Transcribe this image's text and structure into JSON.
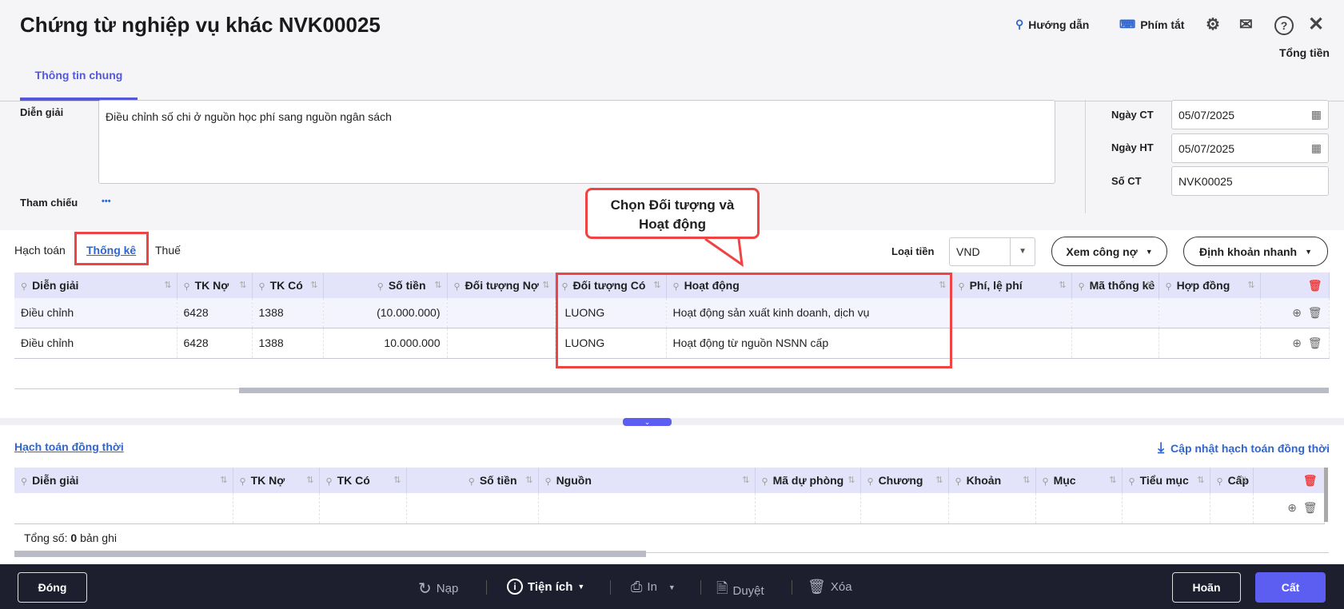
{
  "header": {
    "title": "Chứng từ nghiệp vụ khác NVK00025",
    "guide": "Hướng dẫn",
    "shortcuts": "Phím tắt",
    "total_label": "Tổng tiền"
  },
  "tabs": {
    "general": "Thông tin chung"
  },
  "form": {
    "desc_label": "Diễn giải",
    "desc_value": "Điều chỉnh số chi ở nguồn học phí sang nguồn ngân sách",
    "ref_label": "Tham chiếu",
    "ref_more": "•••",
    "date_ct_label": "Ngày CT",
    "date_ct": "05/07/2025",
    "date_ht_label": "Ngày HT",
    "date_ht": "05/07/2025",
    "so_ct_label": "Số CT",
    "so_ct": "NVK00025"
  },
  "subtabs": [
    "Hạch toán",
    "Thống kê",
    "Thuế"
  ],
  "toolbar": {
    "currency_label": "Loại tiền",
    "currency": "VND",
    "debt": "Xem công nợ",
    "quick": "Định khoản nhanh"
  },
  "callout": {
    "line1": "Chọn Đối tượng và",
    "line2": "Hoạt động"
  },
  "grid": {
    "columns": [
      "Diễn giải",
      "TK Nợ",
      "TK Có",
      "Số tiền",
      "Đối tượng Nợ",
      "Đối tượng Có",
      "Hoạt động",
      "Phí, lệ phí",
      "Mã thống kê",
      "Hợp đồng"
    ],
    "rows": [
      [
        "Điều chỉnh",
        "6428",
        "1388",
        "(10.000.000)",
        "",
        "LUONG",
        "Hoạt động sản xuất kinh doanh, dịch vụ",
        "",
        "",
        ""
      ],
      [
        "Điều chỉnh",
        "6428",
        "1388",
        "10.000.000",
        "",
        "LUONG",
        "Hoạt động từ nguồn NSNN cấp",
        "",
        "",
        ""
      ]
    ]
  },
  "concurrent": {
    "title": "Hạch toán đồng thời",
    "update": "Cập nhật hạch toán đồng thời",
    "columns": [
      "Diễn giải",
      "TK Nợ",
      "TK Có",
      "Số tiền",
      "Nguồn",
      "Mã dự phòng",
      "Chương",
      "Khoản",
      "Mục",
      "Tiểu mục",
      "Cấp"
    ],
    "total_prefix": "Tổng số:",
    "total_count": "0",
    "total_suffix": "bản ghi"
  },
  "footer": {
    "close": "Đóng",
    "reload": "Nạp",
    "utilities": "Tiện ích",
    "print": "In",
    "approve": "Duyệt",
    "delete": "Xóa",
    "cancel": "Hoãn",
    "save": "Cất"
  }
}
